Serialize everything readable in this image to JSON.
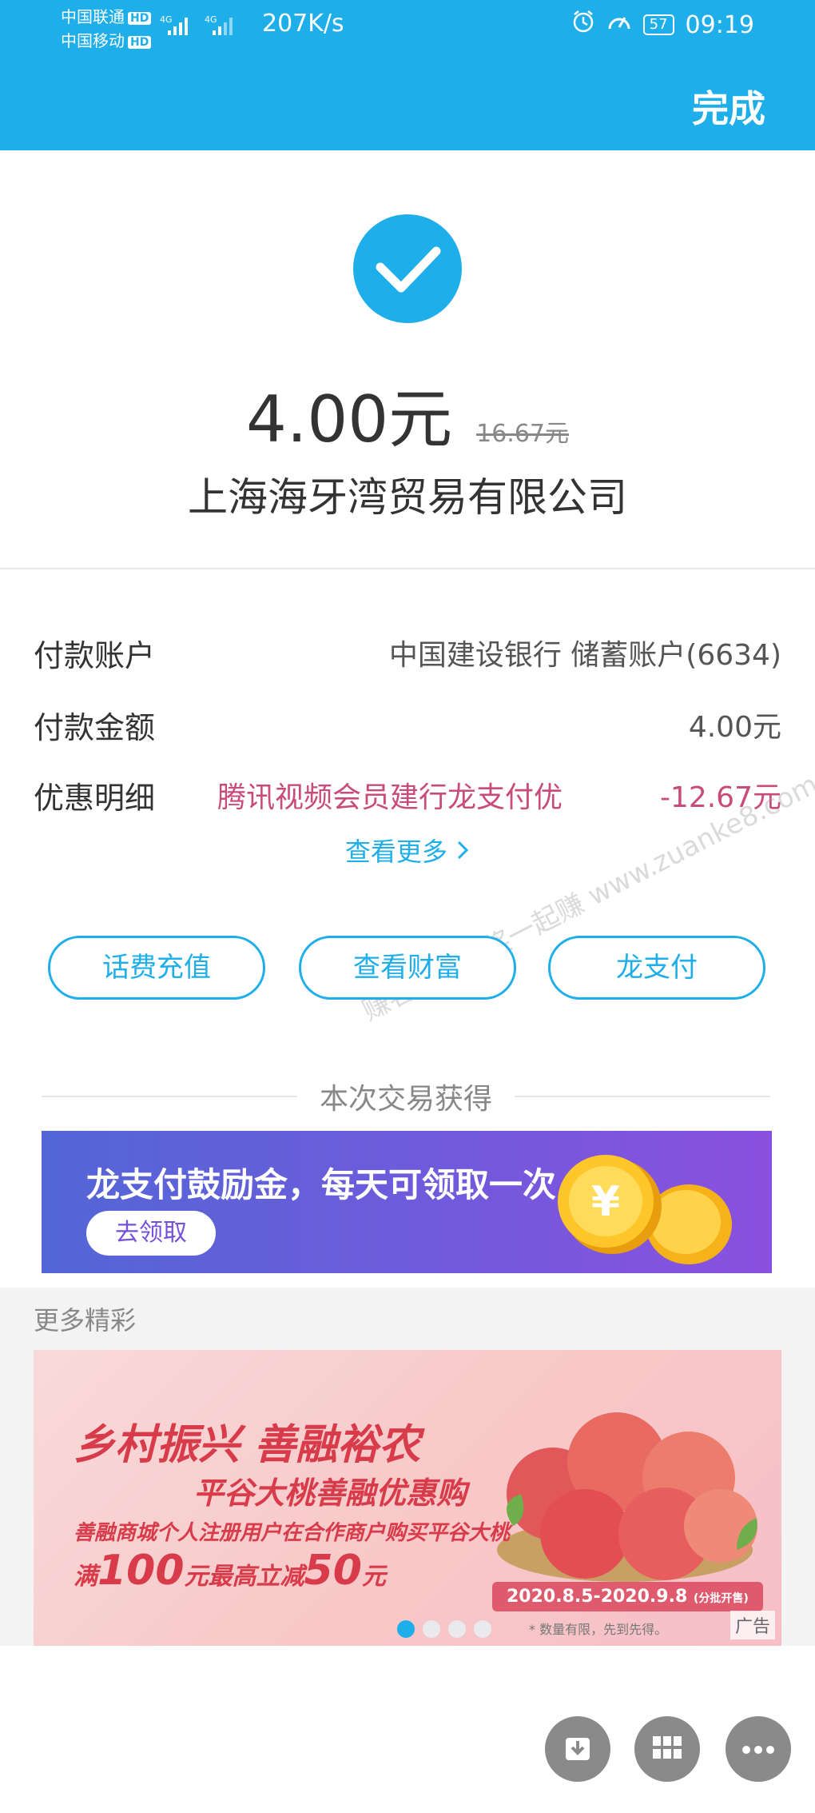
{
  "status_bar": {
    "carrier1": "中国联通",
    "carrier2": "中国移动",
    "hd_label": "HD",
    "net_label": "4G",
    "speed": "207K/s",
    "battery": "57",
    "time": "09:19"
  },
  "header": {
    "done_label": "完成"
  },
  "payment": {
    "amount": "4.00元",
    "original_amount": "16.67元",
    "merchant": "上海海牙湾贸易有限公司"
  },
  "details": {
    "account_label": "付款账户",
    "account_value": "中国建设银行 储蓄账户(6634)",
    "pay_amount_label": "付款金额",
    "pay_amount_value": "4.00元",
    "discount_label": "优惠明细",
    "discount_name": "腾讯视频会员建行龙支付优",
    "discount_value": "-12.67元",
    "see_more": "查看更多"
  },
  "watermark": "赚客吧，有奖一起赚 www.zuanke8.com",
  "actions": [
    {
      "label": "话费充值"
    },
    {
      "label": "查看财富"
    },
    {
      "label": "龙支付"
    }
  ],
  "rewards": {
    "heading": "本次交易获得",
    "banner_title": "龙支付鼓励金，每天可领取一次",
    "claim_label": "去领取",
    "coin_symbol": "¥"
  },
  "more": {
    "title": "更多精彩",
    "ad": {
      "title": "乡村振兴 善融裕农",
      "subtitle_a": "平谷大桃善融",
      "subtitle_b": "优惠购",
      "desc": "善融商城个人注册用户在合作商户购买平谷大桃",
      "offer_pre": "满",
      "offer_amount": "100",
      "offer_mid": "元最高立减",
      "offer_discount": "50",
      "offer_unit": "元",
      "date": "2020.8.5-2020.9.8",
      "date_note": "(分批开售)",
      "note": "* 数量有限，先到先得。",
      "tag": "广告"
    },
    "carousel": {
      "count": 4,
      "active": 0
    }
  },
  "colors": {
    "primary": "#1eaeea",
    "discount": "#c94b79",
    "banner_start": "#5266d6",
    "banner_end": "#8a50e0",
    "ad_red": "#d83b4a"
  }
}
